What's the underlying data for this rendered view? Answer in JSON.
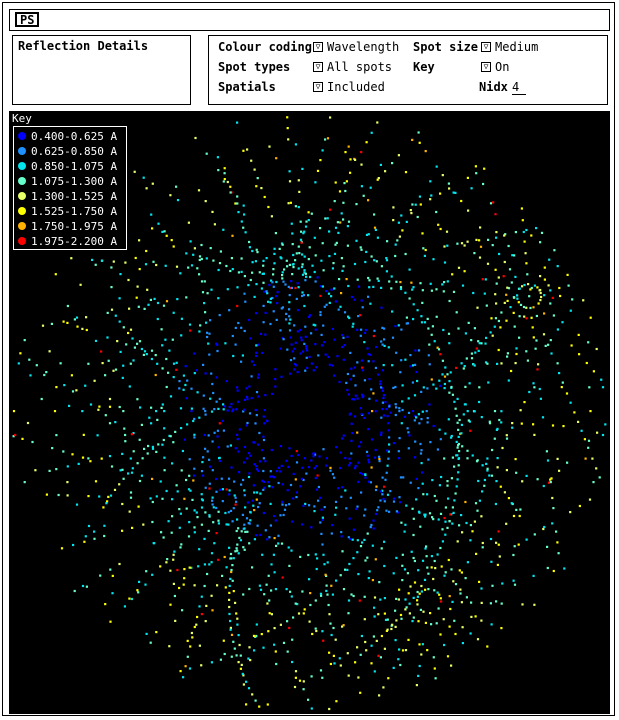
{
  "window": {
    "title": "PS"
  },
  "details": {
    "title": "Reflection Details"
  },
  "controls": {
    "colour_coding": {
      "label": "Colour coding",
      "value": "Wavelength"
    },
    "spot_size": {
      "label": "Spot size",
      "value": "Medium"
    },
    "spot_types": {
      "label": "Spot types",
      "value": "All spots"
    },
    "key": {
      "label": "Key",
      "value": "On"
    },
    "spatials": {
      "label": "Spatials",
      "value": "Included"
    },
    "nidx": {
      "label": "Nidx",
      "value": "4"
    }
  },
  "icons": {
    "dropdown": "dropdown-triangle-icon"
  },
  "legend": {
    "title": "Key",
    "items": [
      {
        "label": "0.400-0.625 A",
        "color": "#0000ff"
      },
      {
        "label": "0.625-0.850 A",
        "color": "#1e90ff"
      },
      {
        "label": "0.850-1.075 A",
        "color": "#00e5ee"
      },
      {
        "label": "1.075-1.300 A",
        "color": "#66ffcc"
      },
      {
        "label": "1.300-1.525 A",
        "color": "#e6ff66"
      },
      {
        "label": "1.525-1.750 A",
        "color": "#ffff00"
      },
      {
        "label": "1.750-1.975 A",
        "color": "#ffb300"
      },
      {
        "label": "1.975-2.200 A",
        "color": "#ff0000"
      }
    ]
  }
}
